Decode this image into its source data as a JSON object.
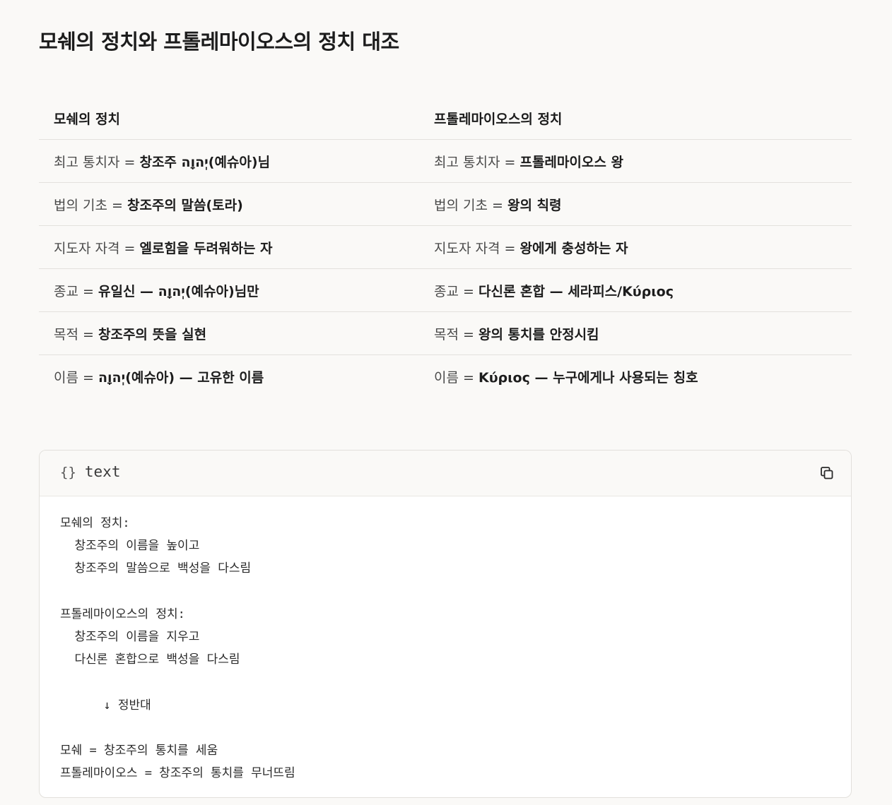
{
  "title": "모쉐의 정치와 프톨레마이오스의 정치 대조",
  "table": {
    "headers": [
      "모쉐의 정치",
      "프톨레마이오스의 정치"
    ],
    "rows": [
      {
        "left": {
          "label": "최고 통치자",
          "eq": "=",
          "value": "창조주 יְהוָה(예슈아)님"
        },
        "right": {
          "label": "최고 통치자",
          "eq": "=",
          "value": "프톨레마이오스 왕"
        }
      },
      {
        "left": {
          "label": "법의 기초",
          "eq": "=",
          "value": "창조주의 말씀(토라)"
        },
        "right": {
          "label": "법의 기초",
          "eq": "=",
          "value": "왕의 칙령"
        }
      },
      {
        "left": {
          "label": "지도자 자격",
          "eq": "=",
          "value": "엘로힘을 두려워하는 자"
        },
        "right": {
          "label": "지도자 자격",
          "eq": "=",
          "value": "왕에게 충성하는 자"
        }
      },
      {
        "left": {
          "label": "종교",
          "eq": "=",
          "value": "유일신 — יְהוָה(예슈아)님만"
        },
        "right": {
          "label": "종교",
          "eq": "=",
          "value": "다신론 혼합 — 세라피스/Κύριος"
        }
      },
      {
        "left": {
          "label": "목적",
          "eq": "=",
          "value": "창조주의 뜻을 실현"
        },
        "right": {
          "label": "목적",
          "eq": "=",
          "value": "왕의 통치를 안정시킴"
        }
      },
      {
        "left": {
          "label": "이름",
          "eq": "=",
          "value": "יְהוָה(예슈아) — 고유한 이름"
        },
        "right": {
          "label": "이름",
          "eq": "=",
          "value": "Κύριος — 누구에게나 사용되는 칭호"
        }
      }
    ]
  },
  "code": {
    "braces": "{}",
    "language": "text",
    "copy_icon": "copy-icon",
    "lines": [
      "모쉐의 정치:",
      "  창조주의 이름을 높이고",
      "  창조주의 말씀으로 백성을 다스림",
      "",
      "프톨레마이오스의 정치:",
      "  창조주의 이름을 지우고",
      "  다신론 혼합으로 백성을 다스림",
      "",
      "      ↓ 정반대",
      "",
      "모쉐 = 창조주의 통치를 세움",
      "프톨레마이오스 = 창조주의 통치를 무너뜨림"
    ]
  }
}
